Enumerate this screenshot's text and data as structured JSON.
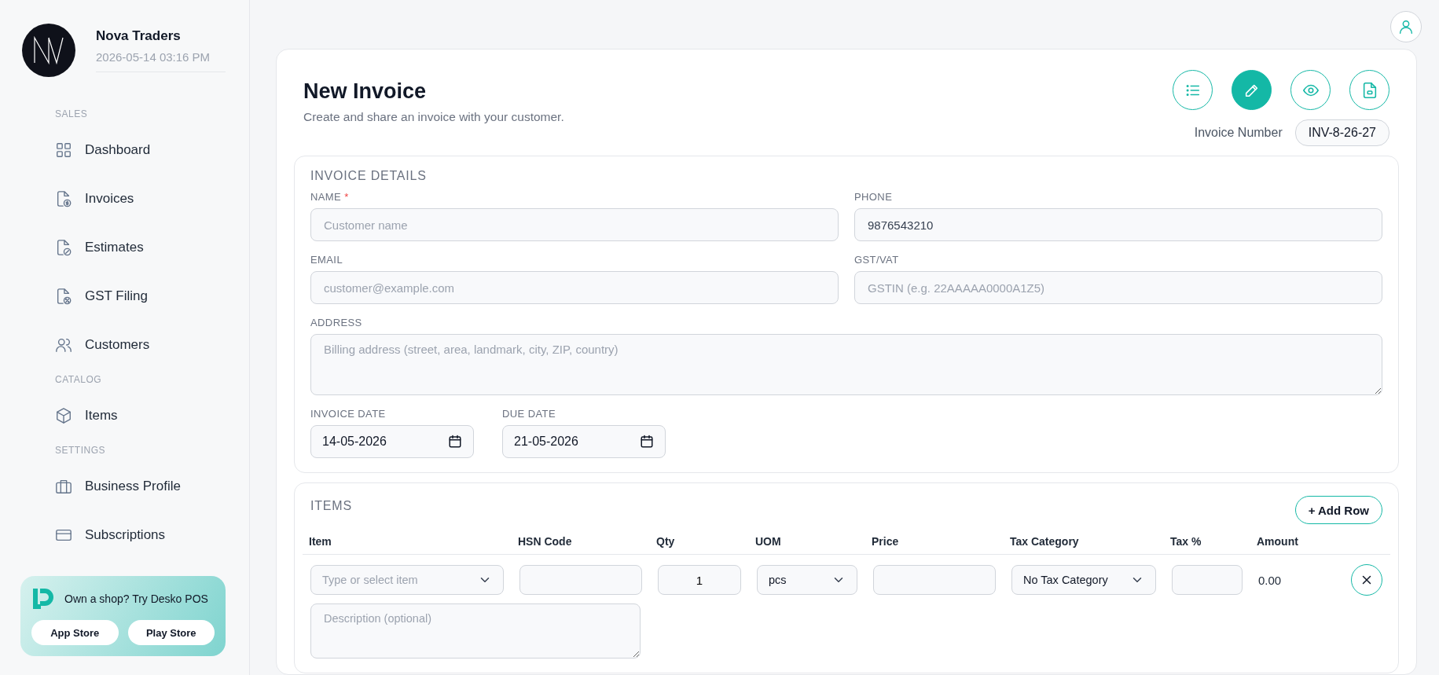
{
  "business": {
    "name": "Nova Traders",
    "timestamp": "2026-05-14 03:16 PM"
  },
  "sidebar": {
    "sections": [
      {
        "title": "SALES",
        "items": [
          {
            "label": "Dashboard"
          },
          {
            "label": "Invoices"
          },
          {
            "label": "Estimates"
          },
          {
            "label": "GST Filing"
          },
          {
            "label": "Customers"
          }
        ]
      },
      {
        "title": "CATALOG",
        "items": [
          {
            "label": "Items"
          }
        ]
      },
      {
        "title": "SETTINGS",
        "items": [
          {
            "label": "Business Profile"
          },
          {
            "label": "Subscriptions"
          }
        ]
      }
    ],
    "promo": {
      "text": "Own a shop? Try Desko POS",
      "buttons": [
        "App Store",
        "Play Store"
      ]
    }
  },
  "page": {
    "title": "New Invoice",
    "subtitle": "Create and share an invoice with your customer.",
    "actions": [
      {
        "selected": false
      },
      {
        "selected": true
      },
      {
        "selected": false
      },
      {
        "selected": false
      }
    ],
    "invoice_number": {
      "label": "Invoice Number",
      "value": "INV-8-26-27"
    }
  },
  "invoice_details": {
    "title": "INVOICE DETAILS",
    "fields": [
      {
        "label": "NAME",
        "required_marker": "*",
        "placeholder": "Customer name"
      },
      {
        "label": "PHONE",
        "value": "9876543210"
      },
      {
        "label": "EMAIL",
        "placeholder": "customer@example.com"
      },
      {
        "label": "GST/VAT",
        "placeholder": "GSTIN (e.g. 22AAAAA0000A1Z5)"
      }
    ],
    "address": {
      "label": "ADDRESS",
      "placeholder": "Billing address (street, area, landmark, city, ZIP, country)"
    },
    "dates": [
      {
        "label": "INVOICE DATE",
        "value": "14-05-2026"
      },
      {
        "label": "DUE DATE",
        "value": "21-05-2026"
      }
    ]
  },
  "items": {
    "title": "ITEMS",
    "add_button": "+ Add Row",
    "columns": [
      "Item",
      "HSN Code",
      "Qty",
      "UOM",
      "Price",
      "Tax Category",
      "Tax %",
      "Amount"
    ],
    "rows": [
      {
        "item": {
          "placeholder": "Type or select item"
        },
        "hsn": "",
        "qty": "1",
        "uom": "pcs",
        "price": "",
        "tax_category": "No Tax Category",
        "tax_percent": "",
        "amount": "0.00",
        "description": {
          "placeholder": "Description (optional)"
        }
      }
    ]
  }
}
